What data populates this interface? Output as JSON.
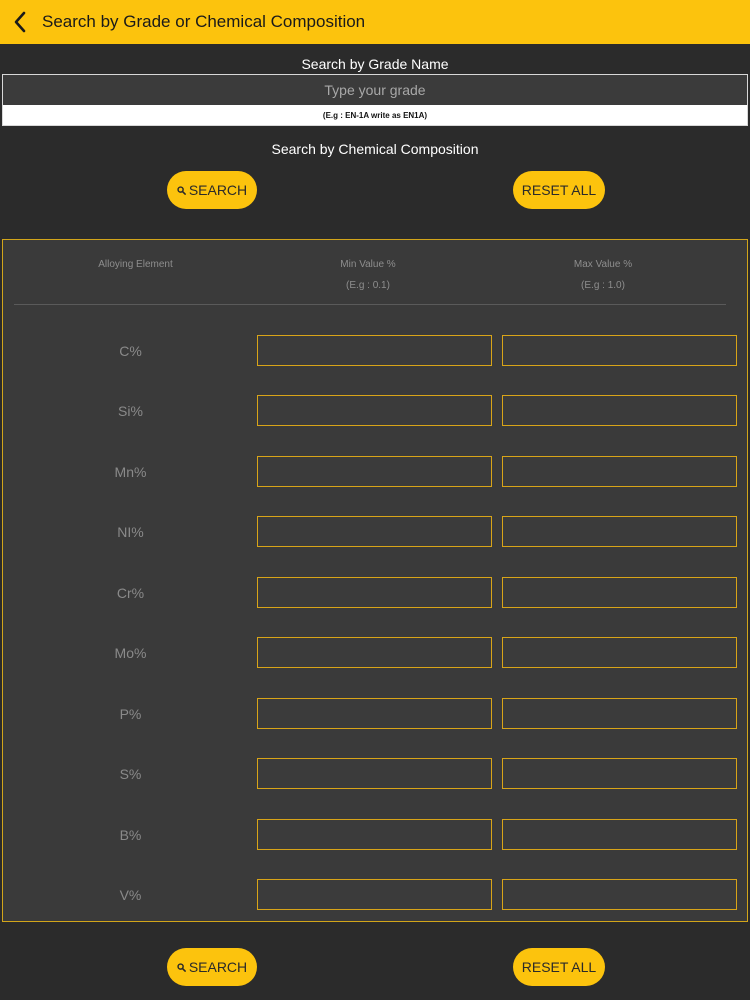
{
  "header": {
    "title": "Search by Grade or Chemical Composition"
  },
  "grade": {
    "label": "Search by Grade Name",
    "placeholder": "Type your grade",
    "hint": "(E.g : EN-1A write as EN1A)"
  },
  "chemical": {
    "label": "Search by Chemical Composition"
  },
  "buttons": {
    "search": "SEARCH",
    "reset": "RESET ALL"
  },
  "table": {
    "headers": {
      "element": "Alloying Element",
      "min": "Min Value %",
      "min_example": "(E.g : 0.1)",
      "max": "Max Value %",
      "max_example": "(E.g : 1.0)"
    },
    "rows": [
      {
        "label": "C%"
      },
      {
        "label": "Si%"
      },
      {
        "label": "Mn%"
      },
      {
        "label": "NI%"
      },
      {
        "label": "Cr%"
      },
      {
        "label": "Mo%"
      },
      {
        "label": "P%"
      },
      {
        "label": "S%"
      },
      {
        "label": "B%"
      },
      {
        "label": "V%"
      }
    ]
  },
  "colors": {
    "accent": "#fcc30d",
    "background": "#2b2b2b",
    "panel": "#3a3a3a"
  }
}
